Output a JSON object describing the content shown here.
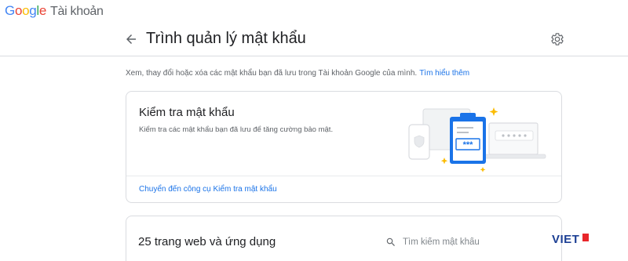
{
  "app": {
    "logo_letters": [
      "G",
      "o",
      "o",
      "g",
      "l",
      "e"
    ],
    "product": "Tài khoản"
  },
  "header": {
    "title": "Trình quản lý mật khẩu"
  },
  "intro": {
    "text": "Xem, thay đổi hoặc xóa các mật khẩu bạn đã lưu trong Tài khoản Google của mình.",
    "link": "Tìm hiểu thêm"
  },
  "checkup": {
    "title": "Kiểm tra mật khẩu",
    "description": "Kiểm tra các mật khẩu bạn đã lưu để tăng cường bảo mật.",
    "link": "Chuyển đến công cụ Kiểm tra mật khẩu",
    "illustration_mask": "***"
  },
  "sites": {
    "title": "25 trang web và ứng dụng",
    "search_placeholder": "Tìm kiếm mật khẩu"
  },
  "watermark": {
    "text": "VIET"
  },
  "colors": {
    "accent": "#1a73e8",
    "text_primary": "#202124",
    "text_secondary": "#5f6368",
    "border": "#dadce0",
    "illustration_blue": "#1a73e8",
    "illustration_yellow": "#fbbc04"
  },
  "icons": {
    "back": "arrow-left-icon",
    "settings": "gear-icon",
    "search": "search-icon"
  }
}
